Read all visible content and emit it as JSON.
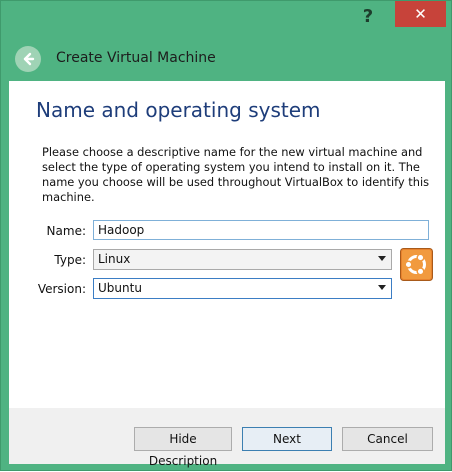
{
  "window": {
    "help_label": "?",
    "close_label": "✕"
  },
  "header": {
    "title": "Create Virtual Machine",
    "back_icon": "back-arrow-icon"
  },
  "page": {
    "title": "Name and operating system",
    "description": "Please choose a descriptive name for the new virtual machine and select the type of operating system you intend to install on it. The name you choose will be used throughout VirtualBox to identify this machine."
  },
  "form": {
    "name_label": "Name:",
    "name_value": "Hadoop",
    "type_label": "Type:",
    "type_value": "Linux",
    "version_label": "Version:",
    "version_value": "Ubuntu",
    "os_icon": "ubuntu-os-icon"
  },
  "footer": {
    "hide_description_label": "Hide Description",
    "next_label": "Next",
    "cancel_label": "Cancel"
  },
  "colors": {
    "window_frame": "#4fb382",
    "close_button": "#c7433a",
    "title_text": "#1e3d7a"
  }
}
